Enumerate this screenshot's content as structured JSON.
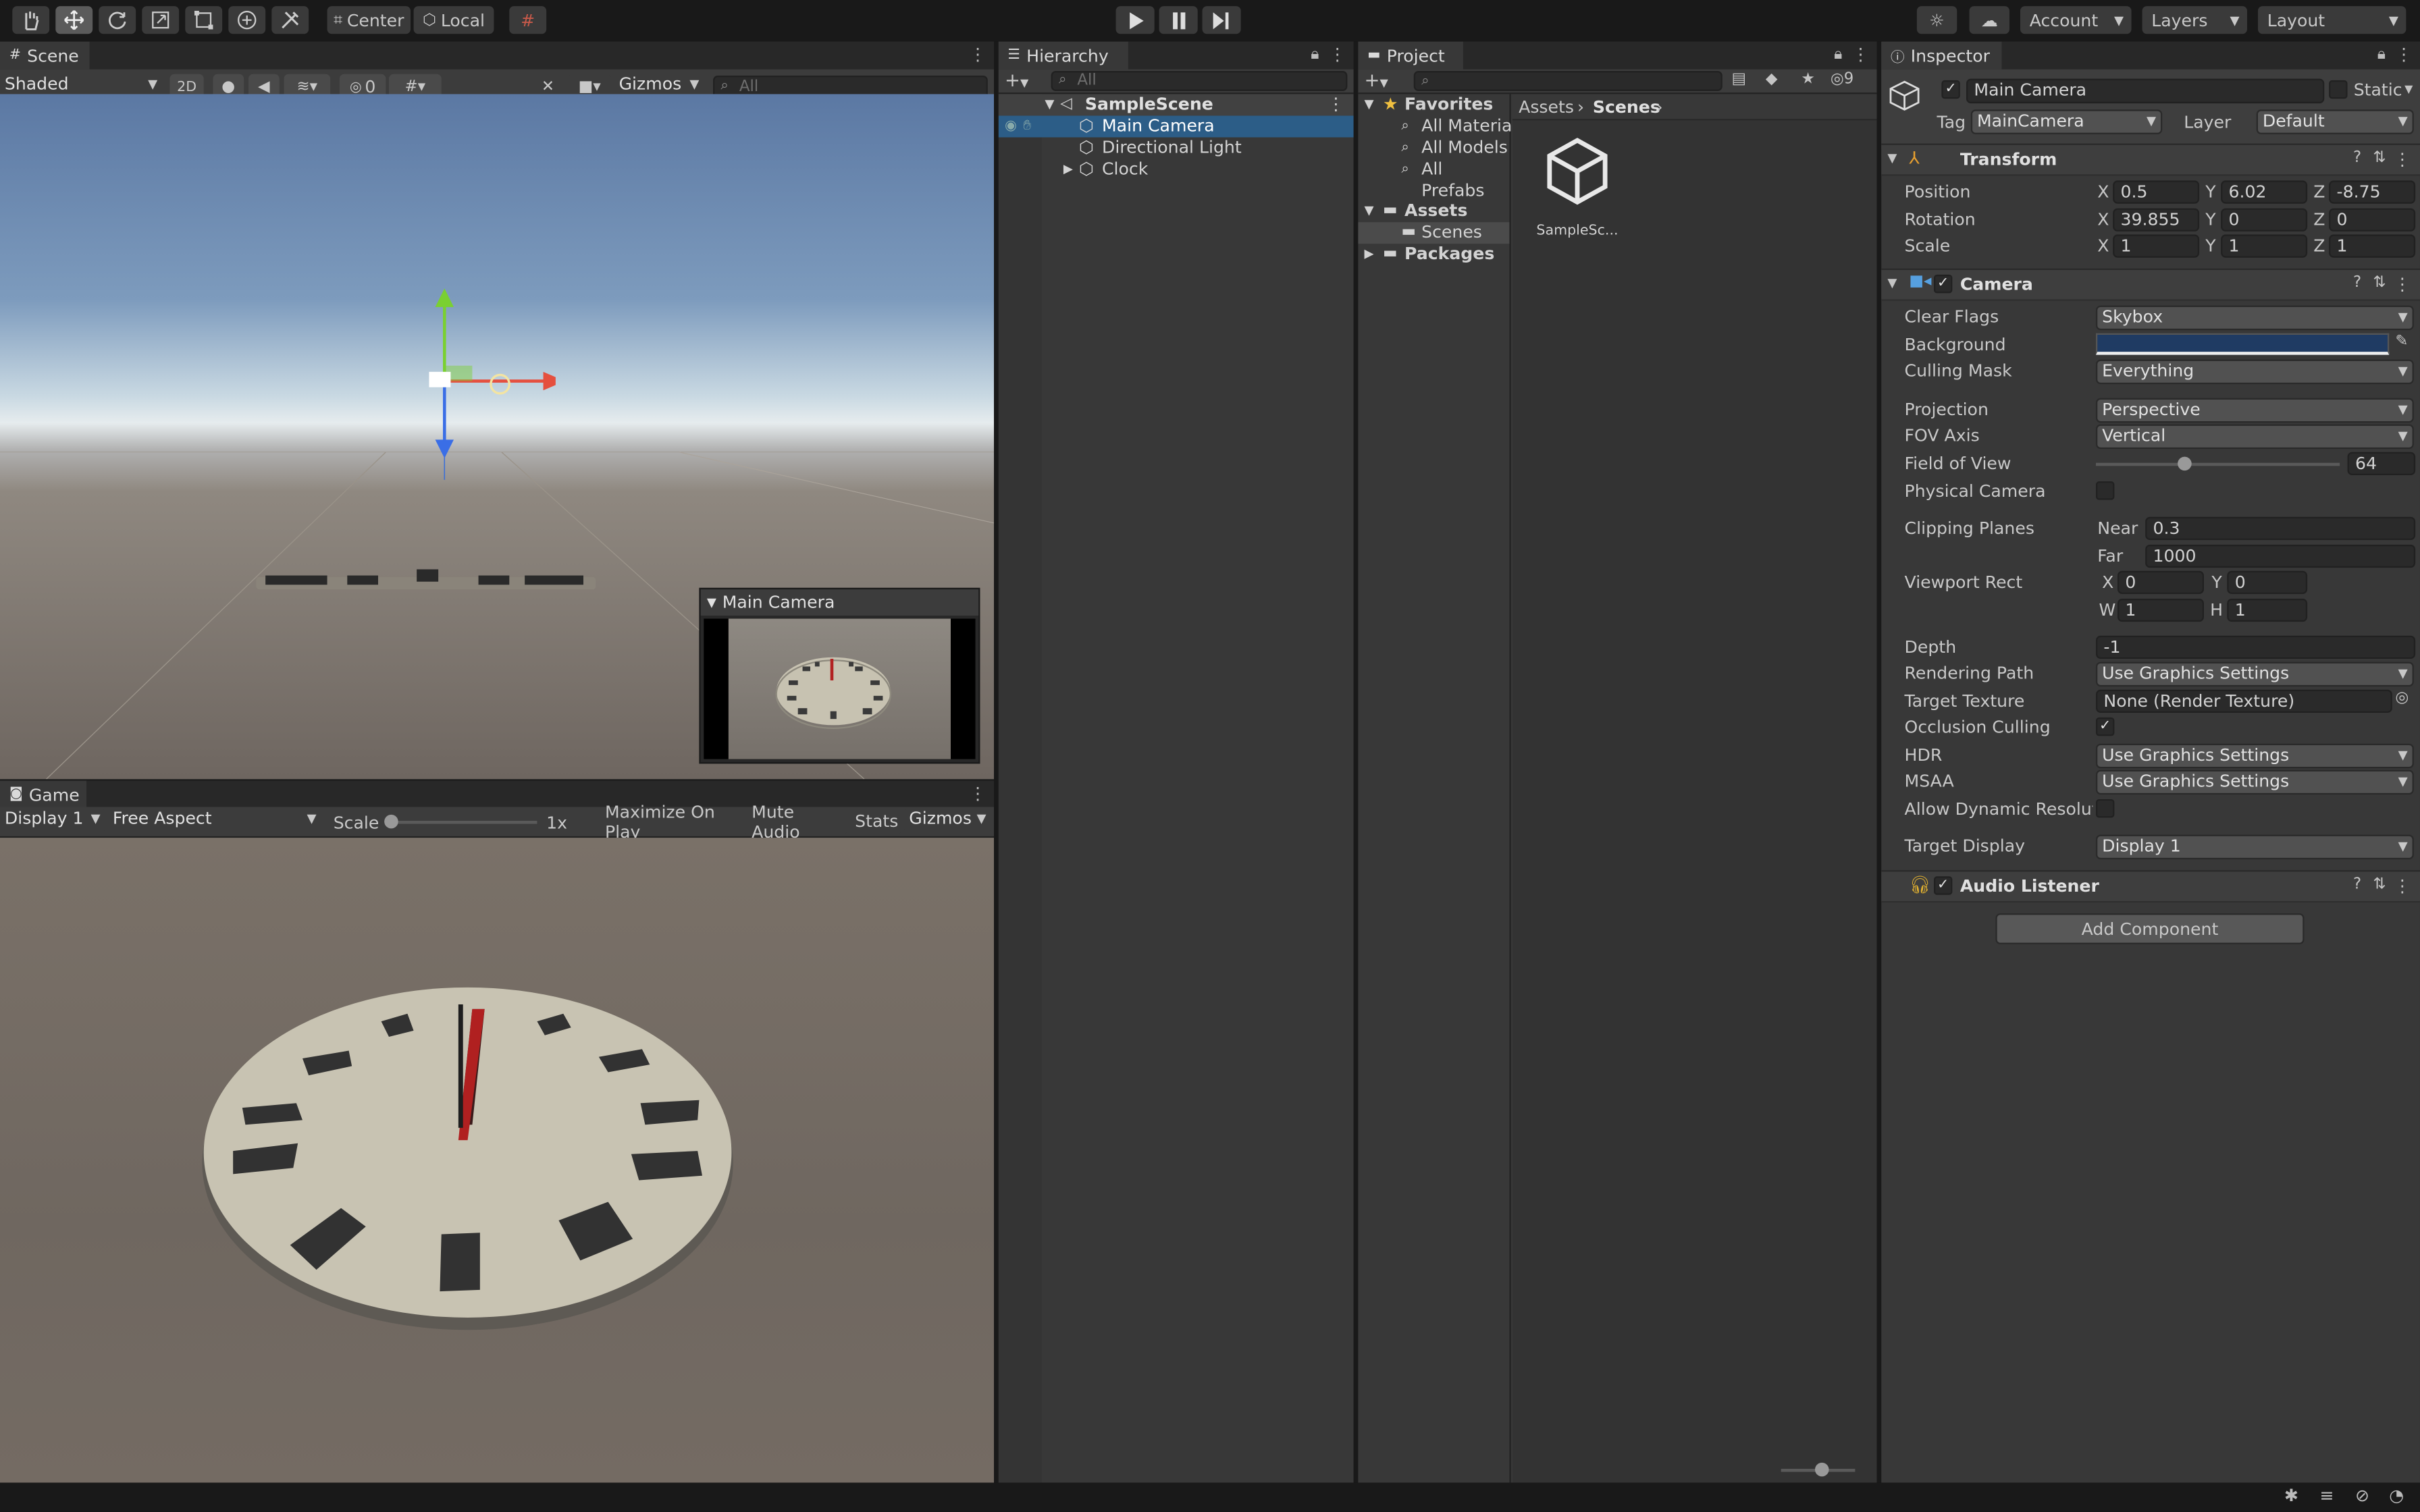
{
  "toolbar": {
    "center": "Center",
    "local": "Local",
    "account": "Account",
    "layers": "Layers",
    "layout": "Layout"
  },
  "scene": {
    "tab": "Scene",
    "shading": "Shaded",
    "mode2d": "2D",
    "hidden_count": "0",
    "gizmos": "Gizmos",
    "search_placeholder": "All",
    "camera_preview_title": "Main Camera"
  },
  "game": {
    "tab": "Game",
    "display": "Display 1",
    "aspect": "Free Aspect",
    "scale_label": "Scale",
    "scale_value": "1x",
    "maximize": "Maximize On Play",
    "mute": "Mute Audio",
    "stats": "Stats",
    "gizmos": "Gizmos"
  },
  "hierarchy": {
    "tab": "Hierarchy",
    "search_placeholder": "All",
    "scene": "SampleScene",
    "items": [
      "Main Camera",
      "Directional Light",
      "Clock"
    ]
  },
  "project": {
    "tab": "Project",
    "hidden_count": "9",
    "favorites": "Favorites",
    "fav_items": [
      "All Materials",
      "All Models",
      "All Prefabs"
    ],
    "assets": "Assets",
    "scenes": "Scenes",
    "packages": "Packages",
    "breadcrumb": [
      "Assets",
      "Scenes"
    ],
    "file": "SampleSc..."
  },
  "inspector": {
    "tab": "Inspector",
    "object_name": "Main Camera",
    "static": "Static",
    "tag_label": "Tag",
    "tag": "MainCamera",
    "layer_label": "Layer",
    "layer": "Default",
    "transform": {
      "title": "Transform",
      "position_label": "Position",
      "rotation_label": "Rotation",
      "scale_label": "Scale",
      "position": [
        "0.5",
        "6.02",
        "-8.75"
      ],
      "rotation": [
        "39.855",
        "0",
        "0"
      ],
      "scale": [
        "1",
        "1",
        "1"
      ]
    },
    "camera": {
      "title": "Camera",
      "clear_flags_label": "Clear Flags",
      "clear_flags": "Skybox",
      "background_label": "Background",
      "background_color": "#1f3b63",
      "culling_label": "Culling Mask",
      "culling": "Everything",
      "projection_label": "Projection",
      "projection": "Perspective",
      "fov_axis_label": "FOV Axis",
      "fov_axis": "Vertical",
      "fov_label": "Field of View",
      "fov": "64",
      "fov_fraction": 0.36,
      "physical_label": "Physical Camera",
      "clipping_label": "Clipping Planes",
      "near_label": "Near",
      "near": "0.3",
      "far_label": "Far",
      "far": "1000",
      "viewport_label": "Viewport Rect",
      "vx": "0",
      "vy": "0",
      "vw": "1",
      "vh": "1",
      "depth_label": "Depth",
      "depth": "-1",
      "rendering_label": "Rendering Path",
      "rendering": "Use Graphics Settings",
      "target_texture_label": "Target Texture",
      "target_texture": "None (Render Texture)",
      "occlusion_label": "Occlusion Culling",
      "hdr_label": "HDR",
      "hdr": "Use Graphics Settings",
      "msaa_label": "MSAA",
      "msaa": "Use Graphics Settings",
      "dynres_label": "Allow Dynamic Resolutio",
      "target_display_label": "Target Display",
      "target_display": "Display 1"
    },
    "audio": {
      "title": "Audio Listener"
    },
    "add_component": "Add Component"
  },
  "icons": {
    "hand": "hand-tool-icon",
    "move": "move-tool-icon",
    "rotate": "rotate-tool-icon",
    "scale": "scale-tool-icon",
    "rect": "rect-tool-icon",
    "transform": "transform-tool-icon",
    "custom": "custom-tool-icon",
    "play": "play-icon",
    "pause": "pause-icon",
    "step": "step-icon"
  }
}
